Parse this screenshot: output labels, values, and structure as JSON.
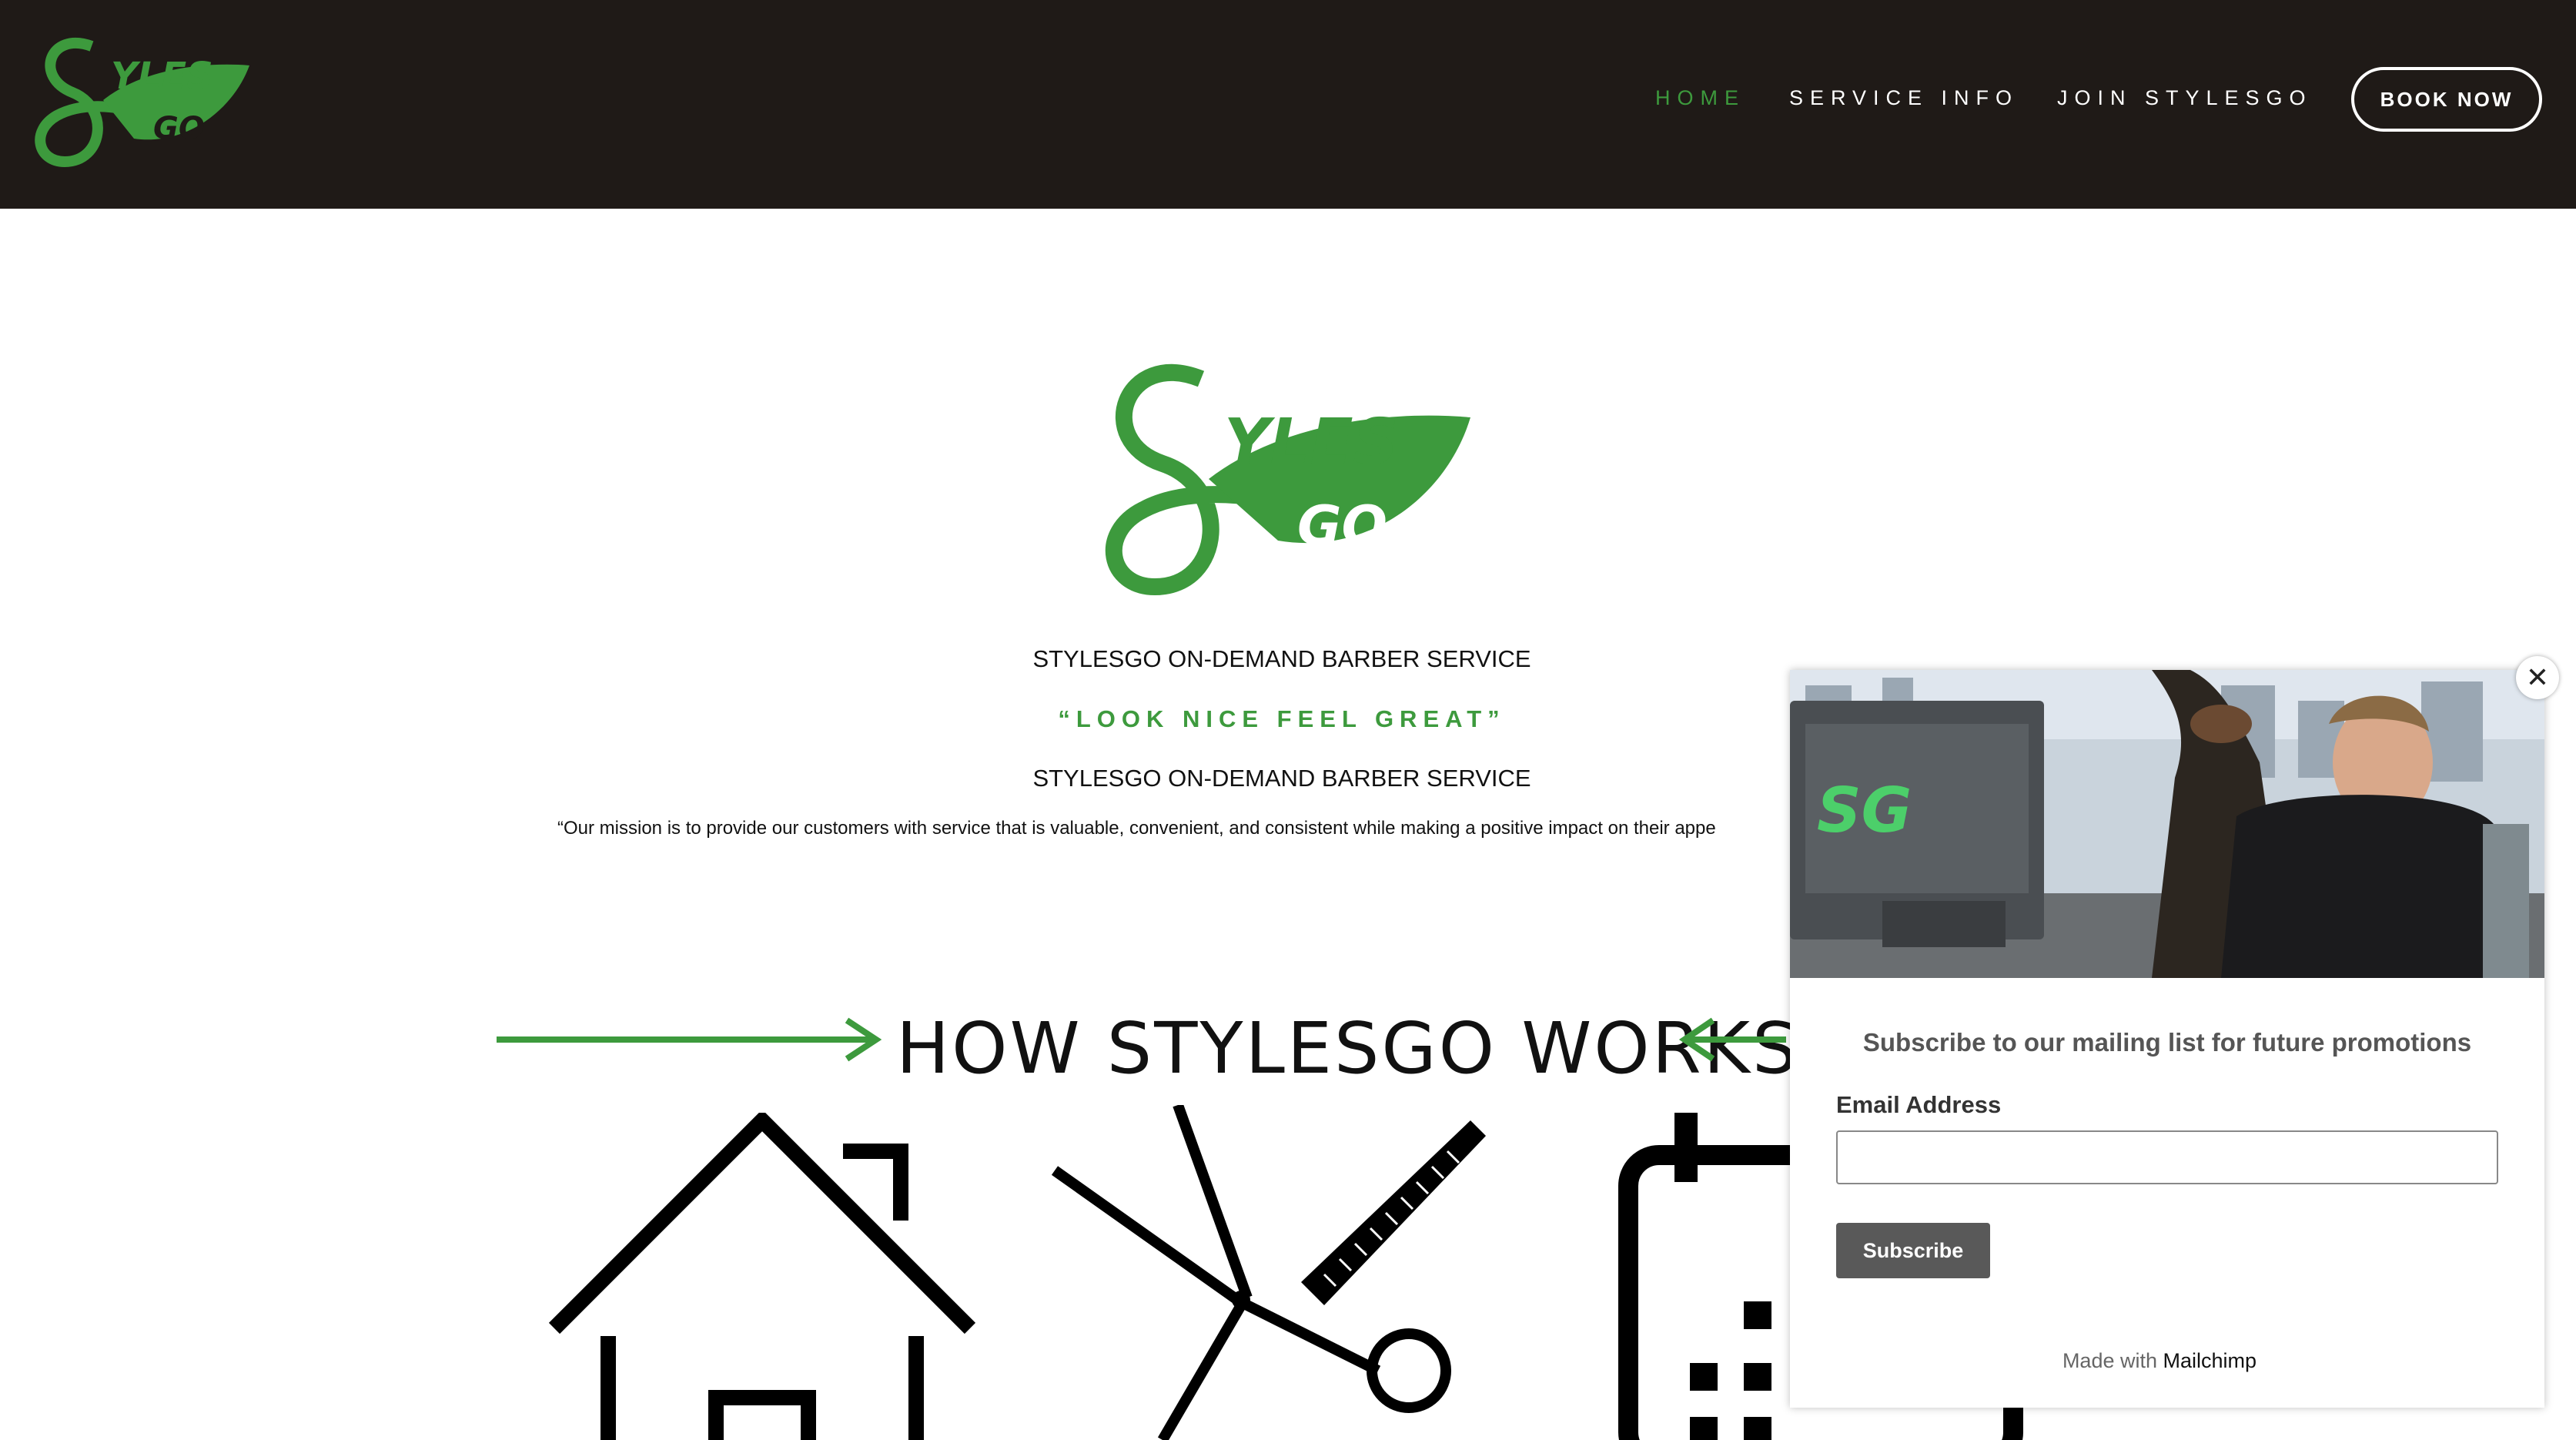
{
  "colors": {
    "header_bg": "#1f1a17",
    "brand_green": "#3d9a3d",
    "button_gray": "#595959"
  },
  "header": {
    "logo_icon": "stylesgo-logo-icon",
    "nav": [
      {
        "label": "HOME",
        "active": true
      },
      {
        "label": "SERVICE INFO",
        "active": false
      },
      {
        "label": "JOIN STYLESGO",
        "active": false
      }
    ],
    "book_label": "BOOK NOW"
  },
  "hero": {
    "logo_icon": "stylesgo-logo-icon",
    "tagline1": "STYLESGO ON-DEMAND BARBER SERVICE",
    "quote": "“LOOK NICE FEEL GREAT”",
    "tagline2": "STYLESGO ON-DEMAND BARBER SERVICE",
    "mission": "“Our mission is to provide our customers with service that is valuable, convenient, and consistent while making a positive impact on their appe"
  },
  "how": {
    "title": "HOW STYLESGO WORKS",
    "icons": [
      "house-icon",
      "scissors-comb-icon",
      "calendar-icon"
    ]
  },
  "popup": {
    "heading": "Subscribe to our mailing list for future promotions",
    "email_label": "Email Address",
    "email_value": "",
    "subscribe_label": "Subscribe",
    "made_with": "Made with",
    "made_with_brand": "Mailchimp",
    "close_icon": "close-icon"
  }
}
